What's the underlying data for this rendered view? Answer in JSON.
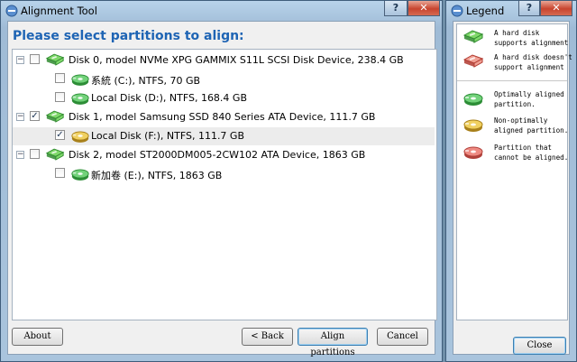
{
  "main_window": {
    "title": "Alignment Tool",
    "help_label": "?",
    "close_label": "✕",
    "heading": "Please select partitions to align:",
    "tree": [
      {
        "level": 0,
        "expander": "−",
        "checked": false,
        "icon": "disk-ok-icon",
        "label": "Disk 0, model NVMe XPG GAMMIX S11L SCSI Disk Device, 238.4 GB"
      },
      {
        "level": 1,
        "checked": false,
        "icon": "partition-aligned-icon",
        "label": "系統 (C:), NTFS, 70 GB"
      },
      {
        "level": 1,
        "checked": false,
        "icon": "partition-aligned-icon",
        "label": "Local Disk (D:), NTFS, 168.4 GB"
      },
      {
        "level": 0,
        "expander": "−",
        "checked": true,
        "icon": "disk-ok-icon",
        "label": "Disk 1, model Samsung SSD 840 Series ATA Device, 111.7 GB"
      },
      {
        "level": 1,
        "checked": true,
        "selected": true,
        "icon": "partition-nonoptimal-icon",
        "label": "Local Disk (F:), NTFS, 111.7 GB"
      },
      {
        "level": 0,
        "expander": "−",
        "checked": false,
        "icon": "disk-ok-icon",
        "label": "Disk 2, model ST2000DM005-2CW102 ATA Device, 1863 GB"
      },
      {
        "level": 1,
        "checked": false,
        "icon": "partition-aligned-icon",
        "label": "新加卷 (E:), NTFS, 1863 GB"
      }
    ],
    "buttons": {
      "about": "About",
      "back": "< Back",
      "align": "Align partitions",
      "cancel": "Cancel"
    }
  },
  "legend_window": {
    "title": "Legend",
    "help_label": "?",
    "close_label": "✕",
    "items": [
      {
        "icon": "disk-ok-icon",
        "text": "A hard disk\nsupports alignment"
      },
      {
        "icon": "disk-unsupported-icon",
        "text": "A hard disk doesn't\nsupport alignment"
      },
      {
        "icon": "partition-aligned-icon",
        "text": "Optimally aligned\npartition."
      },
      {
        "icon": "partition-nonoptimal-icon",
        "text": "Non-optimally\naligned partition."
      },
      {
        "icon": "partition-misaligned-icon",
        "text": "Partition that\ncannot be aligned."
      }
    ],
    "close_button": "Close"
  },
  "colors": {
    "heading": "#1e64b4",
    "green": "#3cb03c",
    "yellow": "#d8a820",
    "red": "#d0453a"
  }
}
